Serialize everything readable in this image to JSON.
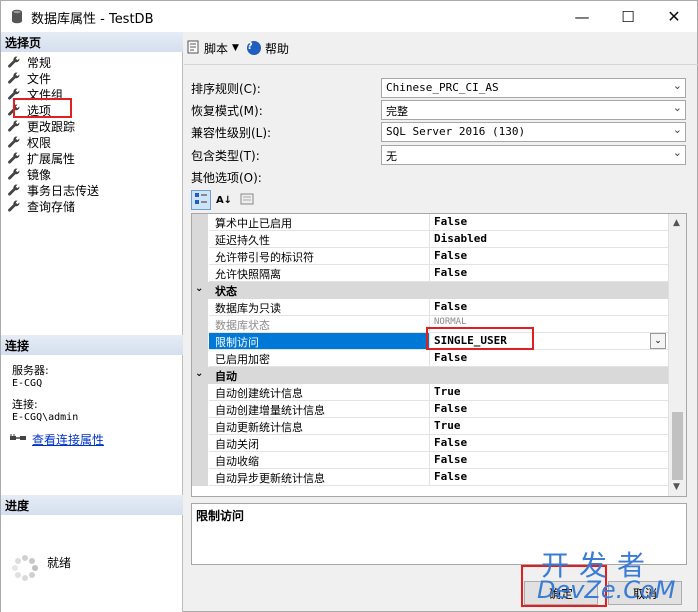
{
  "window": {
    "title": "数据库属性 - TestDB",
    "min_glyph": "—",
    "max_glyph": "☐",
    "close_glyph": "✕"
  },
  "left": {
    "select_page_header": "选择页",
    "pages": [
      {
        "label": "常规"
      },
      {
        "label": "文件"
      },
      {
        "label": "文件组"
      },
      {
        "label": "选项"
      },
      {
        "label": "更改跟踪"
      },
      {
        "label": "权限"
      },
      {
        "label": "扩展属性"
      },
      {
        "label": "镜像"
      },
      {
        "label": "事务日志传送"
      },
      {
        "label": "查询存储"
      }
    ],
    "connection_header": "连接",
    "server_label": "服务器:",
    "server_value": "E-CGQ",
    "connection_label": "连接:",
    "connection_value": "E-CGQ\\admin",
    "view_conn_props": "查看连接属性",
    "progress_header": "进度",
    "progress_status": "就绪"
  },
  "toolbar": {
    "script_label": "脚本",
    "help_label": "帮助"
  },
  "fields": {
    "collation_label": "排序规则(C):",
    "collation_value": "Chinese_PRC_CI_AS",
    "recovery_label": "恢复模式(M):",
    "recovery_value": "完整",
    "compat_label": "兼容性级别(L):",
    "compat_value": "SQL Server 2016 (130)",
    "containment_label": "包含类型(T):",
    "containment_value": "无",
    "other_options_label": "其他选项(O):"
  },
  "grid": {
    "rows": [
      {
        "name": "算术中止已启用",
        "value": "False"
      },
      {
        "name": "延迟持久性",
        "value": "Disabled"
      },
      {
        "name": "允许带引号的标识符",
        "value": "False"
      },
      {
        "name": "允许快照隔离",
        "value": "False"
      },
      {
        "name": "状态",
        "category": true,
        "toggle": "⌄"
      },
      {
        "name": "数据库为只读",
        "value": "False"
      },
      {
        "name": "数据库状态",
        "value": "NORMAL",
        "disabled": true
      },
      {
        "name": "限制访问",
        "value": "SINGLE_USER",
        "selected": true
      },
      {
        "name": "已启用加密",
        "value": "False"
      },
      {
        "name": "自动",
        "category": true,
        "toggle": "⌄"
      },
      {
        "name": "自动创建统计信息",
        "value": "True"
      },
      {
        "name": "自动创建增量统计信息",
        "value": "False"
      },
      {
        "name": "自动更新统计信息",
        "value": "True"
      },
      {
        "name": "自动关闭",
        "value": "False"
      },
      {
        "name": "自动收缩",
        "value": "False"
      },
      {
        "name": "自动异步更新统计信息",
        "value": "False"
      }
    ]
  },
  "description": {
    "title": "限制访问"
  },
  "footer": {
    "ok_label": "确定",
    "cancel_label": "取消"
  },
  "watermark": {
    "line1": "开发者",
    "line2": "DevZe.CoM"
  },
  "colors": {
    "selection_blue": "#0078d7",
    "highlight_red": "#e02020",
    "link_blue": "#0033cc"
  }
}
